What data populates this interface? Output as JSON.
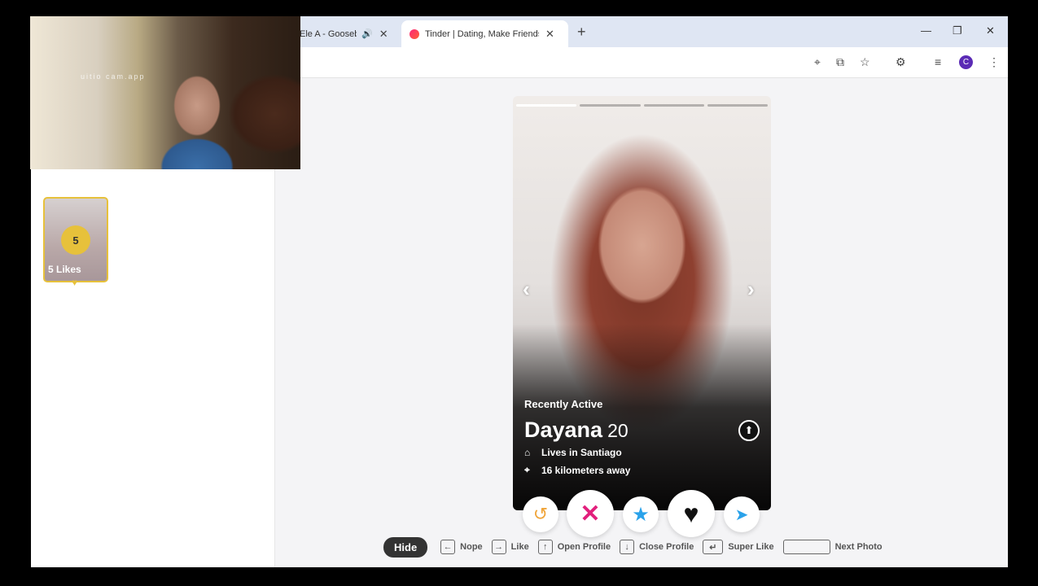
{
  "browser": {
    "tabs": [
      {
        "title": "Ele A - Goosebu",
        "audio_icon": "speaker-icon",
        "close": "✕"
      },
      {
        "title": "Tinder | Dating, Make Friends &",
        "close": "✕"
      }
    ],
    "new_tab": "+",
    "window_controls": {
      "minimize": "—",
      "restore": "❐",
      "close": "✕"
    },
    "profile_initial": "C"
  },
  "sidebar": {
    "likes_count": "5",
    "likes_label": "5 Likes"
  },
  "profile": {
    "status": "Recently Active",
    "name": "Dayana",
    "age": "20",
    "city": "Lives in Santiago",
    "distance": "16 kilometers away",
    "photo_count": 4,
    "current_photo": 1
  },
  "actions": {
    "rewind": "↺",
    "nope": "✕",
    "super_like": "★",
    "like": "♥",
    "boost": "➤"
  },
  "hints": {
    "hide": "Hide",
    "items": [
      {
        "key": "←",
        "label": "Nope"
      },
      {
        "key": "→",
        "label": "Like"
      },
      {
        "key": "↑",
        "label": "Open Profile"
      },
      {
        "key": "↓",
        "label": "Close Profile"
      },
      {
        "key": "↵",
        "label": "Super Like"
      },
      {
        "key": "",
        "label": "Next Photo"
      }
    ]
  },
  "webcam": {
    "watermark": "uitio   cam.app"
  },
  "colors": {
    "accent_gold": "#e7c13b",
    "nope_pink": "#e2207d",
    "super_blue": "#2aa2ea",
    "rewind_orange": "#f0a53b"
  }
}
